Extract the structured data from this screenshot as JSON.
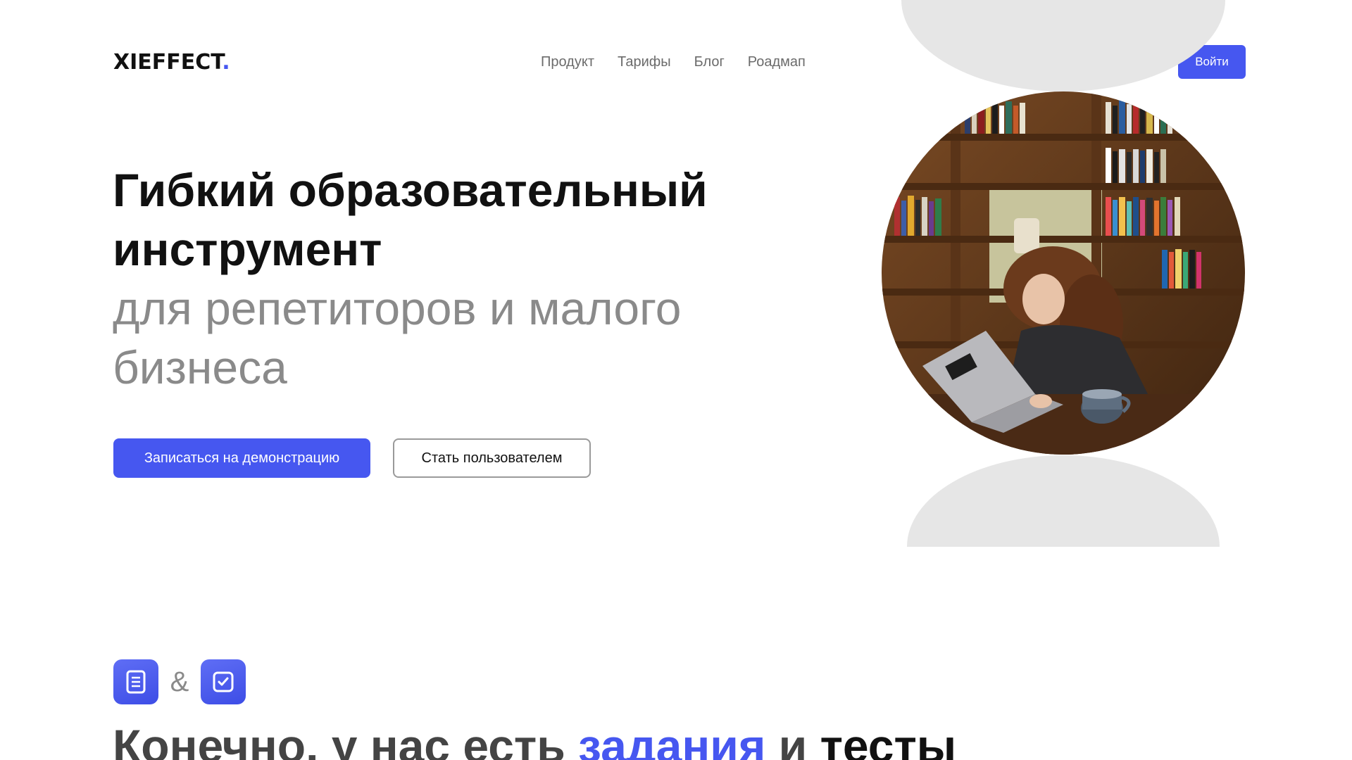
{
  "header": {
    "logo_text": "XIEFFECT",
    "logo_dot": ".",
    "nav": [
      "Продукт",
      "Тарифы",
      "Блог",
      "Роадмап"
    ],
    "login_label": "Войти"
  },
  "hero": {
    "title_line1": "Гибкий образовательный",
    "title_line2": "инструмент",
    "subtitle_line1": "для репетиторов и малого",
    "subtitle_line2": "бизнеса",
    "primary_button": "Записаться на демонстрацию",
    "secondary_button": "Стать пользователем",
    "photo_icon": "girl-with-laptop-photo"
  },
  "features": {
    "icon_left": "document-icon",
    "amp": "&",
    "icon_right": "checkbox-icon",
    "heading_part1": "Конечно, у нас есть ",
    "heading_accent": "задания",
    "heading_part2": " и ",
    "heading_part3": "тесты"
  },
  "colors": {
    "accent": "#4657f0",
    "text": "#111111",
    "muted": "#8a8a8a",
    "decor_gray": "#e6e6e6"
  }
}
